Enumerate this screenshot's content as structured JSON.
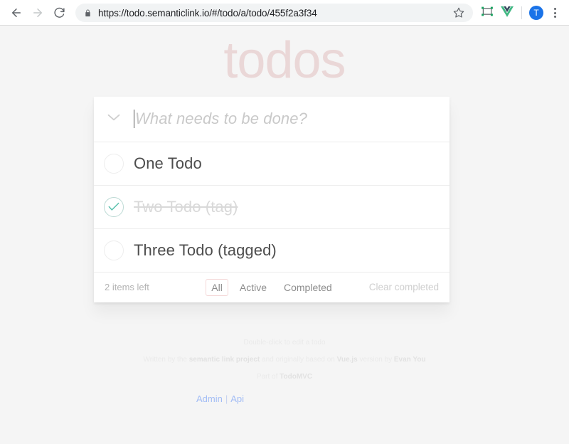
{
  "browser": {
    "back_icon": "back-arrow-icon",
    "forward_icon": "forward-arrow-icon",
    "reload_icon": "reload-icon",
    "lock_icon": "lock-icon",
    "url": "https://todo.semanticlink.io/#/todo/a/todo/455f2a3f34",
    "star_icon": "star-icon",
    "cast_icon": "cast-icon",
    "vue_devtools_icon": "vue-devtools-icon",
    "avatar_initial": "T",
    "menu_icon": "kebab-menu-icon"
  },
  "app": {
    "title": "todos",
    "toggle_all_icon": "chevron-down-icon",
    "new_todo": {
      "value": "",
      "placeholder": "What needs to be done?"
    },
    "todos": [
      {
        "label": "One Todo",
        "completed": false
      },
      {
        "label": "Two Todo (tag)",
        "completed": true
      },
      {
        "label": "Three Todo (tagged)",
        "completed": false
      }
    ],
    "footer": {
      "count_text": "2 items left",
      "filters": [
        {
          "label": "All",
          "selected": true
        },
        {
          "label": "Active",
          "selected": false
        },
        {
          "label": "Completed",
          "selected": false
        }
      ],
      "clear_completed": "Clear completed"
    }
  },
  "info": {
    "line1": "Double-click to edit a todo",
    "line2_a": "Written by the ",
    "line2_b": "semantic link project",
    "line2_c": " and originally based on ",
    "line2_d": "Vue.js",
    "line2_e": " version by ",
    "line2_f": "Evan You",
    "line3_a": "Part of ",
    "line3_b": "TodoMVC"
  },
  "links": {
    "admin": "Admin",
    "separator": "|",
    "api": "Api"
  },
  "colors": {
    "accent_pink": "#ead7d7",
    "filter_border": "#f4d7d7",
    "check_green": "#5dc2af",
    "page_bg": "#f5f5f5",
    "link_blue": "#a3bdf5"
  }
}
